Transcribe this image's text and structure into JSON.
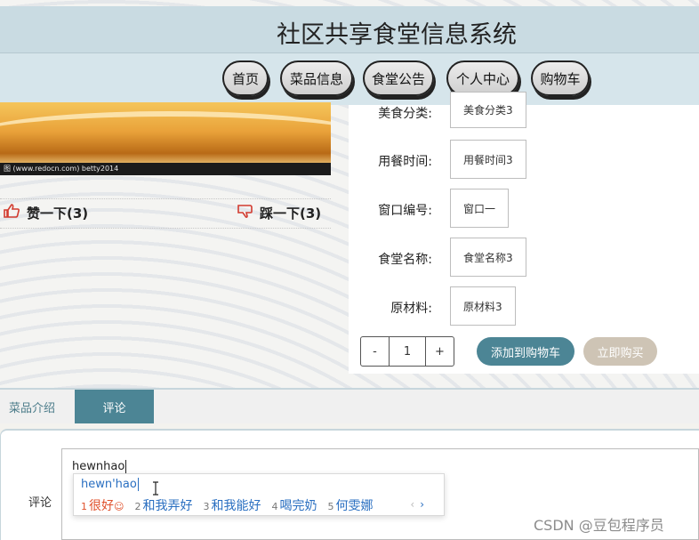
{
  "header": {
    "site_title": "社区共享食堂信息系统"
  },
  "nav": {
    "items": [
      {
        "label": "首页"
      },
      {
        "label": "菜品信息"
      },
      {
        "label": "食堂公告"
      },
      {
        "label": "个人中心"
      },
      {
        "label": "购物车"
      }
    ]
  },
  "product": {
    "photo_caption": "图 (www.redocn.com)   betty2014",
    "like_label": "赞一下(3)",
    "dislike_label": "踩一下(3)",
    "fields": [
      {
        "label": "美食分类:",
        "value": "美食分类3"
      },
      {
        "label": "用餐时间:",
        "value": "用餐时间3"
      },
      {
        "label": "窗口编号:",
        "value": "窗口一"
      },
      {
        "label": "食堂名称:",
        "value": "食堂名称3"
      },
      {
        "label": "原材料:",
        "value": "原材料3"
      }
    ],
    "quantity": {
      "minus": "-",
      "value": "1",
      "plus": "+"
    },
    "add_to_cart_label": "添加到购物车",
    "buy_now_label": "立即购买"
  },
  "tabs": [
    {
      "label": "菜品介绍"
    },
    {
      "label": "评论"
    }
  ],
  "comment": {
    "label": "评论",
    "text": "hewnhao",
    "ime": {
      "pinyin": "hewn'hao",
      "candidates": [
        {
          "num": "1",
          "text": "很好"
        },
        {
          "num": "2",
          "text": "和我弄好"
        },
        {
          "num": "3",
          "text": "和我能好"
        },
        {
          "num": "4",
          "text": "喝完奶"
        },
        {
          "num": "5",
          "text": "何雯娜"
        }
      ],
      "prev": "‹",
      "next": "›"
    }
  },
  "watermark": "CSDN @豆包程序员",
  "icons": {
    "like": "thumbs-up-icon",
    "dislike": "thumbs-down-icon",
    "text_cursor": "text-cursor-icon"
  },
  "colors": {
    "accent": "#4c8595",
    "header_bg": "#c9dbe2",
    "vote_icon": "#d23b2f",
    "buy_button": "#cec4b5"
  }
}
